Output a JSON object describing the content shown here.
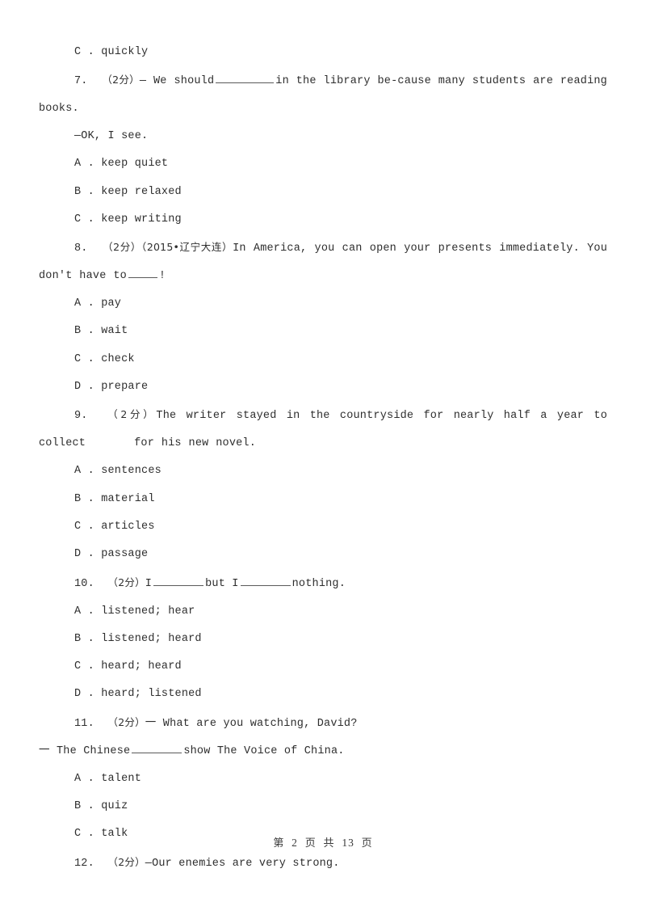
{
  "document": {
    "type": "exam-worksheet",
    "language": "zh-CN / en",
    "background_color": "#ffffff",
    "text_color": "#2e2e2e"
  },
  "footer": {
    "page_label_prefix": "第",
    "page_number": "2",
    "page_unit": "页",
    "total_prefix": "共",
    "total_pages": "13",
    "total_unit": "页",
    "full_text": "第 2 页 共 13 页"
  },
  "orphan_option": {
    "letter": "C",
    "separator": ".",
    "text": "quickly",
    "full_text": "C . quickly"
  },
  "questions": [
    {
      "number": "7.",
      "points": "（2分）",
      "stem_before": "— We should",
      "stem_after": "in the library be-cause many students are reading books.",
      "blank_style": "blank-lg",
      "dialogue_reply": "—OK, I see.",
      "options": [
        {
          "letter": "A",
          "separator": ".",
          "text": "keep quiet",
          "full_text": "A . keep quiet"
        },
        {
          "letter": "B",
          "separator": ".",
          "text": "keep relaxed",
          "full_text": "B . keep relaxed"
        },
        {
          "letter": "C",
          "separator": ".",
          "text": "keep writing",
          "full_text": "C . keep writing"
        }
      ]
    },
    {
      "number": "8.",
      "points": "（2分）",
      "source": "（2015•辽宁大连）",
      "stem_before": "In America, you can open your presents immediately. You don't have to",
      "stem_after": "!",
      "blank_style": "blank-sm",
      "options": [
        {
          "letter": "A",
          "separator": ".",
          "text": "pay",
          "full_text": "A . pay"
        },
        {
          "letter": "B",
          "separator": ".",
          "text": "wait",
          "full_text": "B . wait"
        },
        {
          "letter": "C",
          "separator": ".",
          "text": "check",
          "full_text": "C . check"
        },
        {
          "letter": "D",
          "separator": ".",
          "text": "prepare",
          "full_text": "D . prepare"
        }
      ]
    },
    {
      "number": "9.",
      "points": "（2分）",
      "stem_before": "The writer stayed in the countryside for nearly half a year to collect",
      "stem_after": "for his new novel.",
      "blank_style": "gap-space",
      "options": [
        {
          "letter": "A",
          "separator": ".",
          "text": "sentences",
          "full_text": "A . sentences"
        },
        {
          "letter": "B",
          "separator": ".",
          "text": "material",
          "full_text": "B . material"
        },
        {
          "letter": "C",
          "separator": ".",
          "text": "articles",
          "full_text": "C . articles"
        },
        {
          "letter": "D",
          "separator": ".",
          "text": "passage",
          "full_text": "D . passage"
        }
      ]
    },
    {
      "number": "10.",
      "points": "（2分）",
      "stem_part1": "I",
      "stem_part2": "but I",
      "stem_part3": "nothing.",
      "options": [
        {
          "letter": "A",
          "separator": ".",
          "text": "listened; hear",
          "full_text": "A . listened; hear"
        },
        {
          "letter": "B",
          "separator": ".",
          "text": "listened; heard",
          "full_text": "B . listened; heard"
        },
        {
          "letter": "C",
          "separator": ".",
          "text": "heard; heard",
          "full_text": "C . heard; heard"
        },
        {
          "letter": "D",
          "separator": ".",
          "text": "heard; listened",
          "full_text": "D . heard; listened"
        }
      ]
    },
    {
      "number": "11.",
      "points": "（2分）",
      "stem_before": "一 What are you watching, David?",
      "reply_before": "一 The Chinese",
      "reply_after": "show The Voice of China.",
      "options": [
        {
          "letter": "A",
          "separator": ".",
          "text": "talent",
          "full_text": "A . talent"
        },
        {
          "letter": "B",
          "separator": ".",
          "text": "quiz",
          "full_text": "B . quiz"
        },
        {
          "letter": "C",
          "separator": ".",
          "text": "talk",
          "full_text": "C . talk"
        }
      ]
    },
    {
      "number": "12.",
      "points": "（2分）",
      "stem_before": "—Our enemies are very strong.",
      "options": []
    }
  ]
}
